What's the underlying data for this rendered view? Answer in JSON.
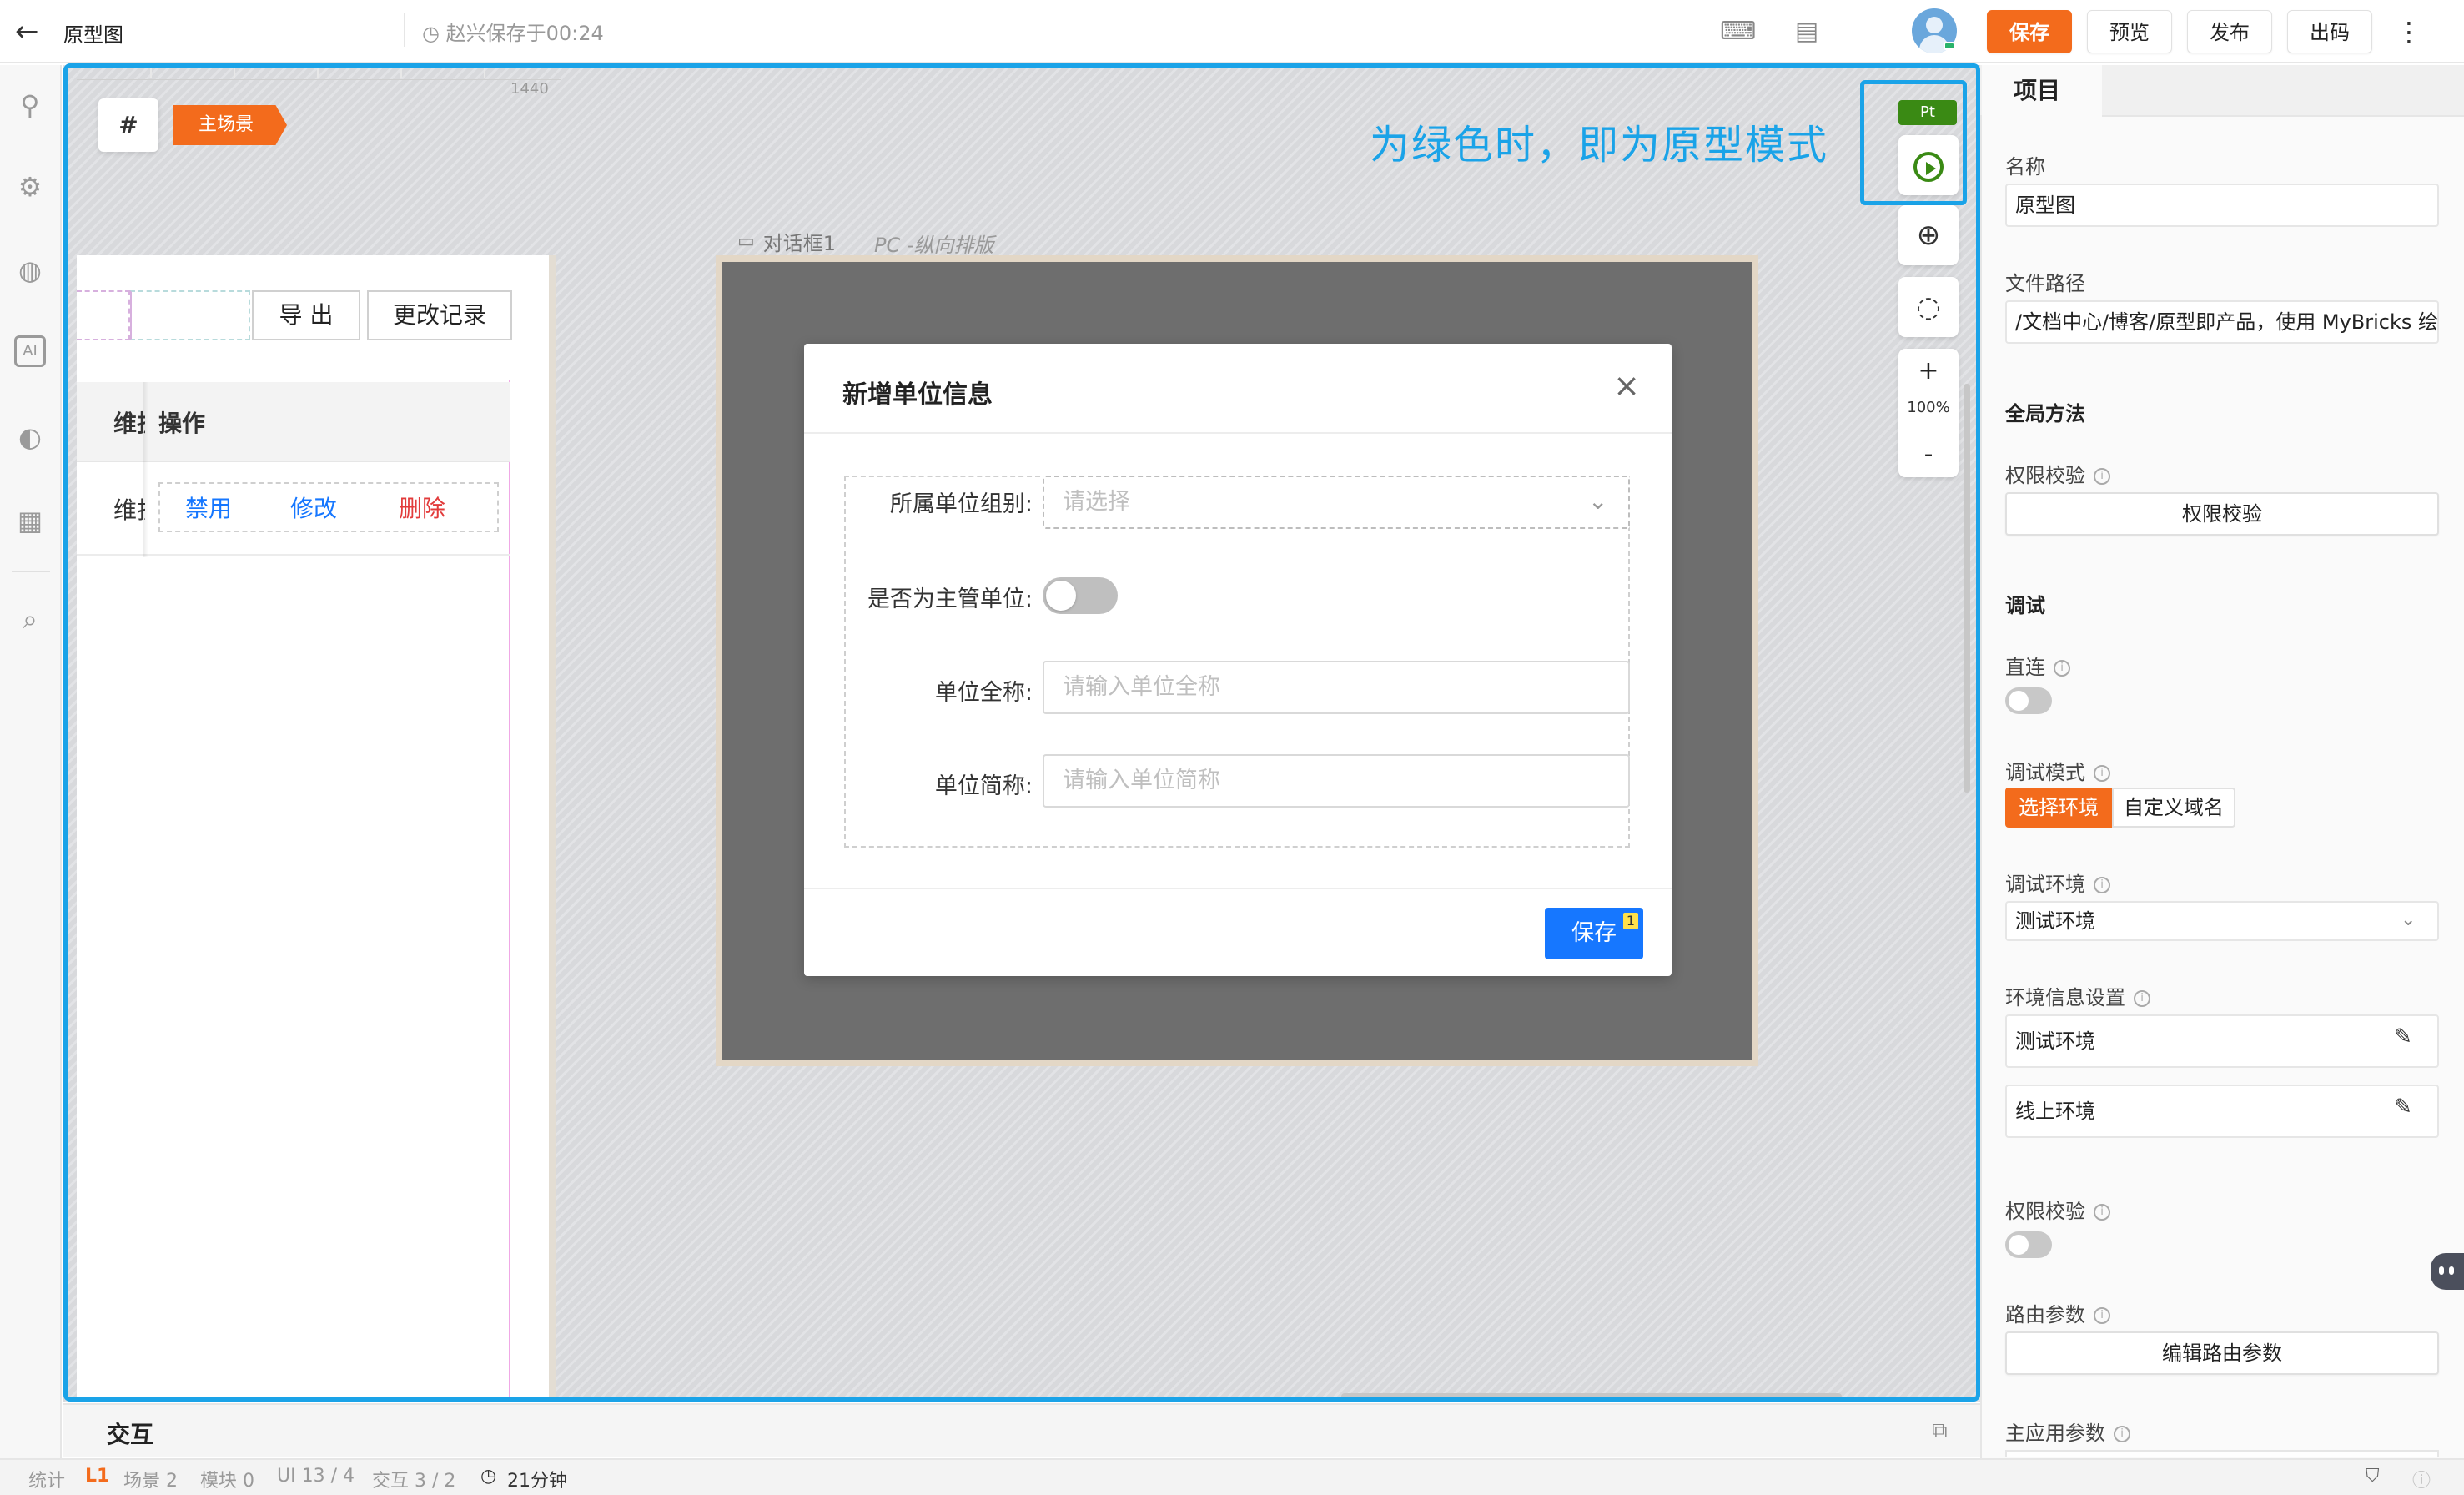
{
  "topbar": {
    "back_icon": "arrow-left-icon",
    "title": "原型图",
    "save_status": "赵兴保存于00:24",
    "buttons": {
      "save": "保存",
      "preview": "预览",
      "publish": "发布",
      "code": "出码",
      "more": "⋮"
    },
    "accent_color": "#f36b1c"
  },
  "left_rail": [
    "plugin-icon",
    "settings-icon",
    "globe-icon",
    "ai-chip-icon",
    "palette-icon",
    "log-icon",
    "search-icon"
  ],
  "canvas": {
    "ruler_number": "1440",
    "hash_label": "#",
    "scene_tag": "主场景",
    "hint": "为绿色时，即为原型模式",
    "hint_color": "#1aa3e8"
  },
  "page_left": {
    "buttons": {
      "export": "导 出",
      "history": "更改记录"
    },
    "table": {
      "headers": [
        "维护",
        "操作"
      ],
      "row_first_cell": "维护",
      "actions": {
        "disable": "禁用",
        "edit": "修改",
        "delete": "删除"
      }
    }
  },
  "frame": {
    "label": "对话框1",
    "layout": "PC -纵向排版"
  },
  "dialog": {
    "title": "新增单位信息",
    "fields": {
      "group": {
        "label": "所属单位组别:",
        "placeholder": "请选择"
      },
      "is_main": {
        "label": "是否为主管单位:",
        "value": false
      },
      "full_name": {
        "label": "单位全称:",
        "placeholder": "请输入单位全称"
      },
      "short_name": {
        "label": "单位简称:",
        "placeholder": "请输入单位简称"
      }
    },
    "save": "保存",
    "save_badge": "1"
  },
  "float_toolbar": {
    "mode_badge": "Pt",
    "mode_color": "#3a8a14",
    "zoom_in": "+",
    "zoom_level": "100%",
    "zoom_out": "-"
  },
  "interaction": {
    "label": "交互"
  },
  "statusbar": {
    "stats": "统计",
    "level": "L1",
    "scenes": "场景 2",
    "modules": "模块 0",
    "ui": "UI 13 / 4",
    "interactions": "交互 3 / 2",
    "time": "21分钟"
  },
  "right_panel": {
    "tab": "项目",
    "name_label": "名称",
    "name_value": "原型图",
    "path_label": "文件路径",
    "path_value": "/文档中心/博客/原型即产品，使用 MyBricks 绘",
    "global_methods": "全局方法",
    "perm_check_label": "权限校验",
    "perm_check_button": "权限校验",
    "debug": "调试",
    "direct_label": "直连",
    "debug_mode_label": "调试模式",
    "debug_mode_options": [
      "选择环境",
      "自定义域名"
    ],
    "debug_env_label": "调试环境",
    "debug_env_value": "测试环境",
    "env_settings_label": "环境信息设置",
    "env_rows": [
      "测试环境",
      "线上环境"
    ],
    "perm_check2_label": "权限校验",
    "route_params_label": "路由参数",
    "route_params_button": "编辑路由参数",
    "main_app_params_label": "主应用参数"
  }
}
